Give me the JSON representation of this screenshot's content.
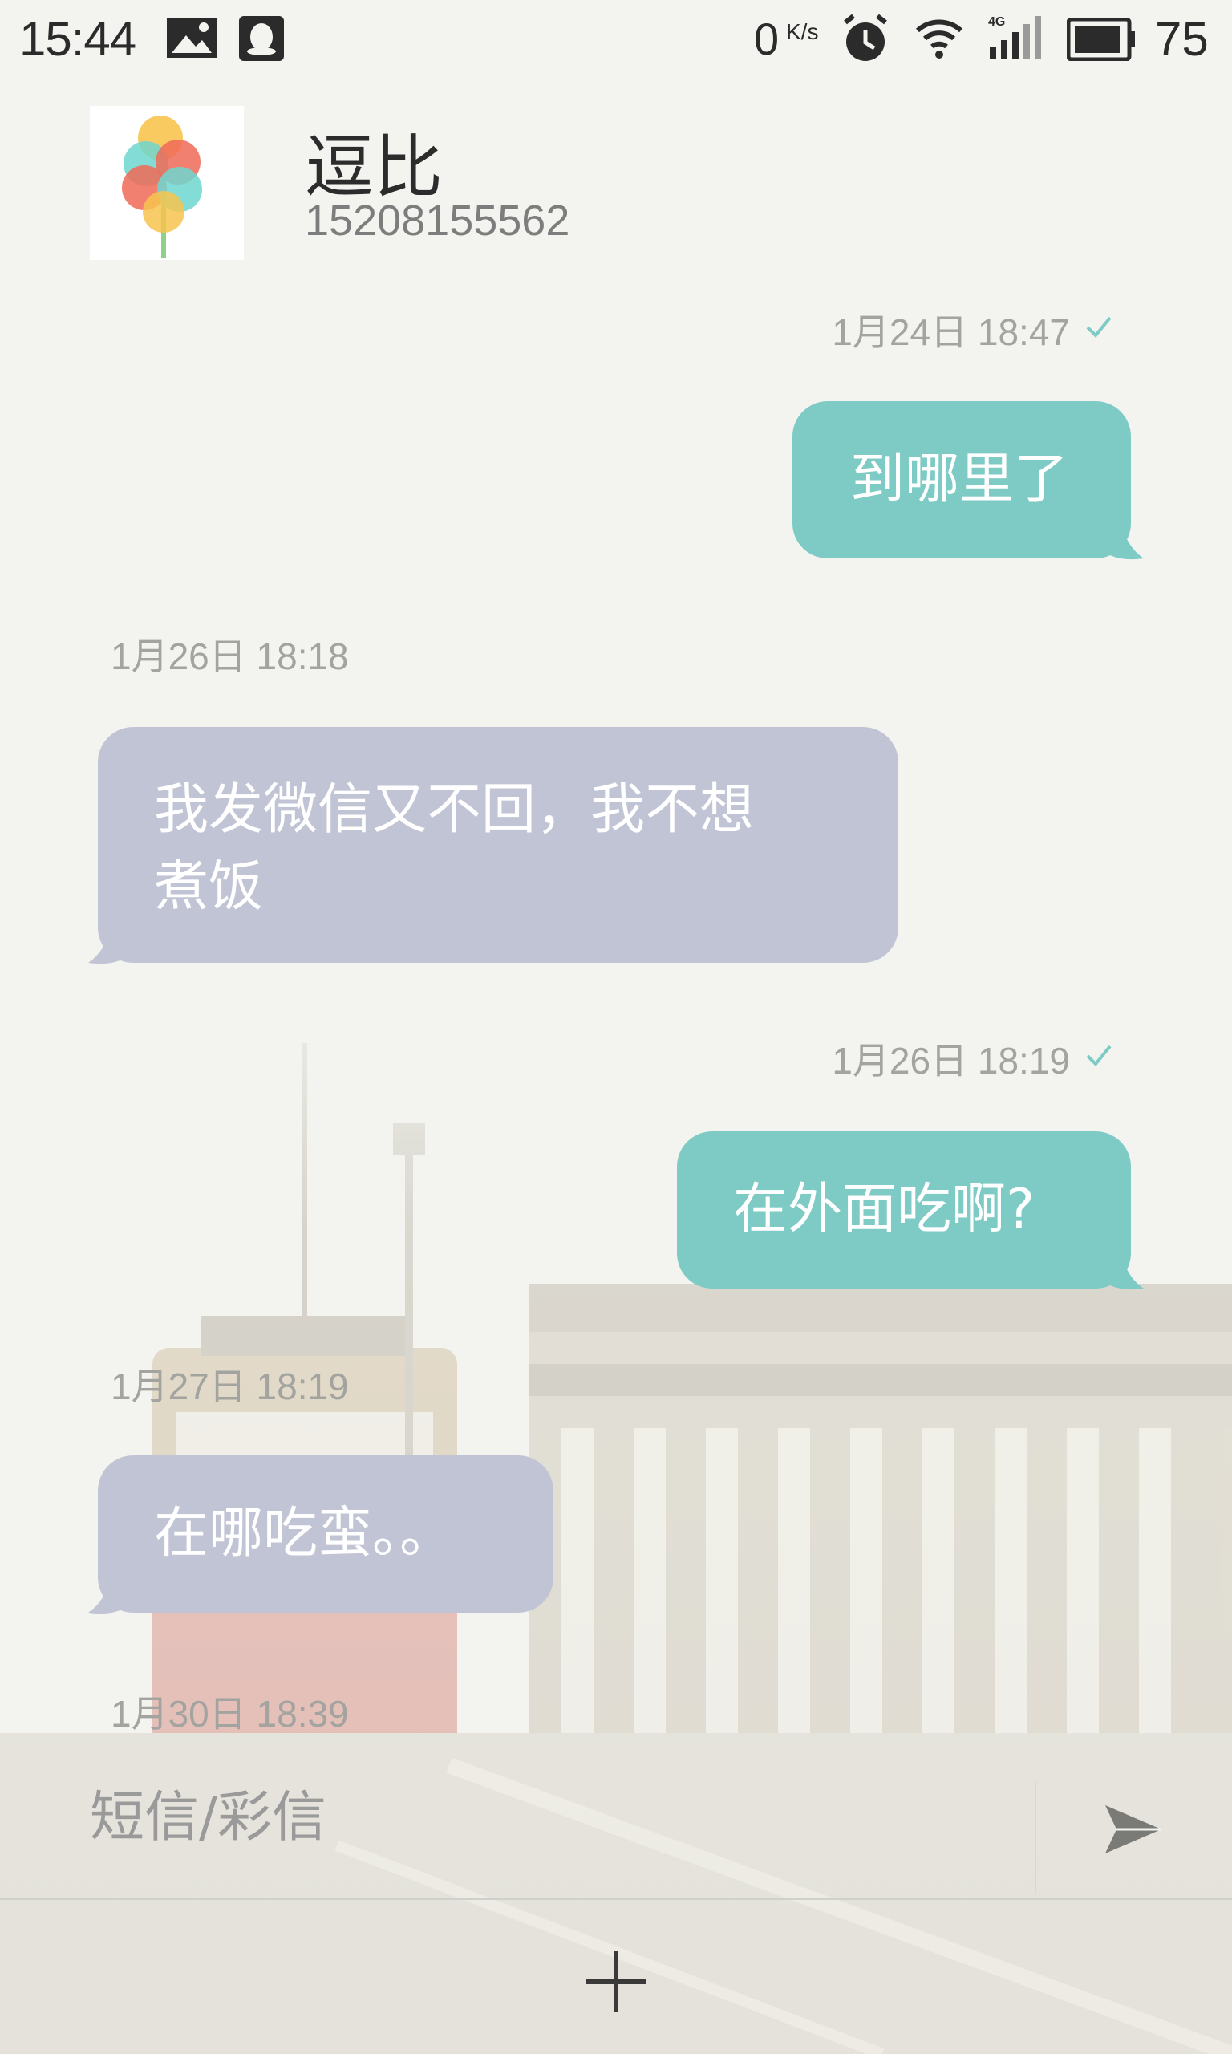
{
  "status_bar": {
    "time": "15:44",
    "net_speed": "0",
    "net_speed_unit": "K/s",
    "network": "4G",
    "battery": "75",
    "icons": [
      "image-icon",
      "qq-icon",
      "alarm-icon",
      "wifi-icon",
      "signal-icon",
      "battery-icon"
    ]
  },
  "contact": {
    "name": "逗比",
    "number": "15208155562"
  },
  "conversation": {
    "messages": [
      {
        "direction": "out",
        "time": "1月24日 18:47",
        "text": "到哪里了",
        "delivered": true
      },
      {
        "direction": "in",
        "time": "1月26日 18:18",
        "text_lines": [
          "我发微信又不回，我不想",
          "煮饭"
        ]
      },
      {
        "direction": "out",
        "time": "1月26日 18:19",
        "text": "在外面吃啊?",
        "delivered": true
      },
      {
        "direction": "in",
        "time": "1月27日 18:19",
        "text": "在哪吃蛮。。"
      }
    ],
    "last_timestamp": "1月30日 18:39"
  },
  "composer": {
    "placeholder": "短信/彩信"
  },
  "colors": {
    "outgoing_bubble": "#7ecbc5",
    "incoming_bubble": "#c1c4d4",
    "delivered_check": "#7ecbc5",
    "background": "#f3f4ef"
  }
}
